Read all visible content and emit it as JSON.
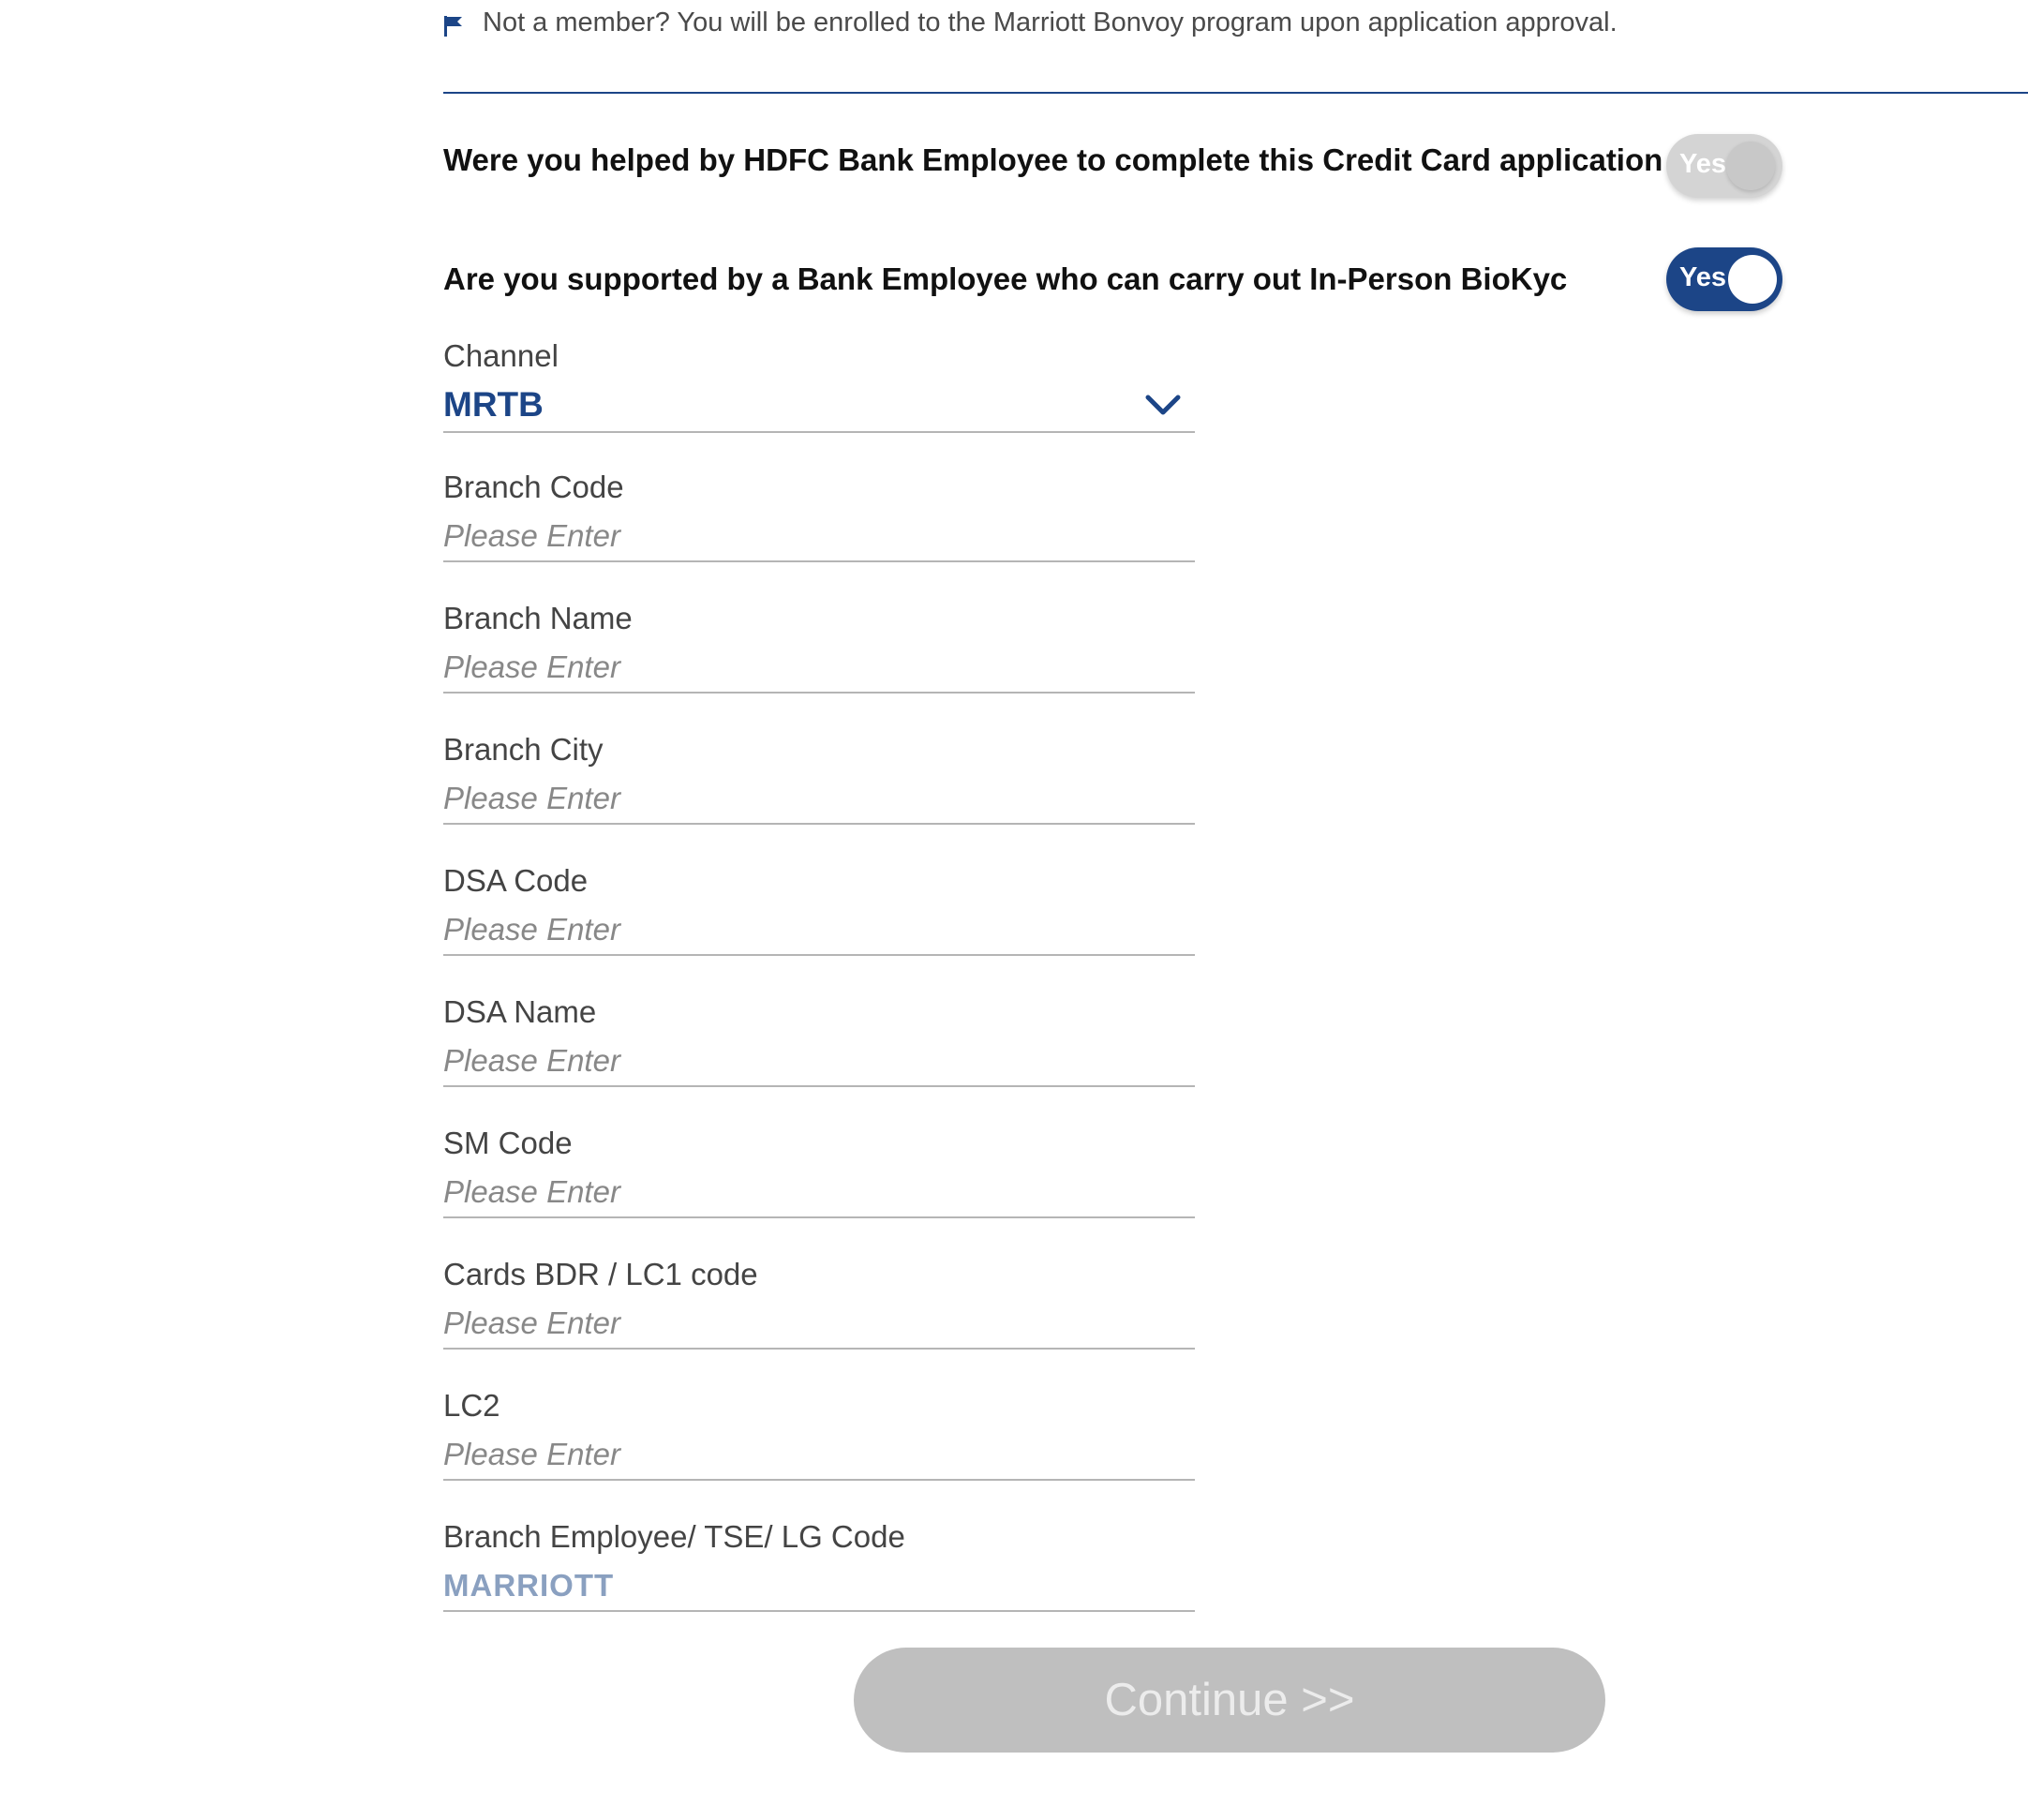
{
  "notice": {
    "text": "Not a member? You will be enrolled to the Marriott Bonvoy program upon application approval.",
    "icon": "flag-icon"
  },
  "questions": {
    "helped_by_employee": {
      "label": "Were you helped by HDFC Bank Employee to complete this Credit Card application",
      "toggle_label": "Yes",
      "state": "off"
    },
    "in_person_biokyc": {
      "label": "Are you supported by a Bank Employee who can carry out In-Person BioKyc",
      "toggle_label": "Yes",
      "state": "on"
    }
  },
  "form": {
    "channel": {
      "label": "Channel",
      "value": "MRTB",
      "icon": "chevron-down-icon"
    },
    "branch_code": {
      "label": "Branch Code",
      "placeholder": "Please Enter"
    },
    "branch_name": {
      "label": "Branch Name",
      "placeholder": "Please Enter"
    },
    "branch_city": {
      "label": "Branch City",
      "placeholder": "Please Enter"
    },
    "dsa_code": {
      "label": "DSA Code",
      "placeholder": "Please Enter"
    },
    "dsa_name": {
      "label": "DSA Name",
      "placeholder": "Please Enter"
    },
    "sm_code": {
      "label": "SM Code",
      "placeholder": "Please Enter"
    },
    "cards_bdr_lc1_code": {
      "label": "Cards BDR / LC1 code",
      "placeholder": "Please Enter"
    },
    "lc2": {
      "label": "LC2",
      "placeholder": "Please Enter"
    },
    "branch_employee_code": {
      "label": "Branch Employee/ TSE/ LG Code",
      "value": "MARRIOTT"
    }
  },
  "actions": {
    "continue_label": "Continue >>",
    "continue_state": "disabled"
  },
  "colors": {
    "brand_blue": "#1c4587",
    "disabled_button": "#bfbfbf",
    "toggle_off": "#d4d4d4",
    "readonly_value": "#8aa0c0"
  }
}
